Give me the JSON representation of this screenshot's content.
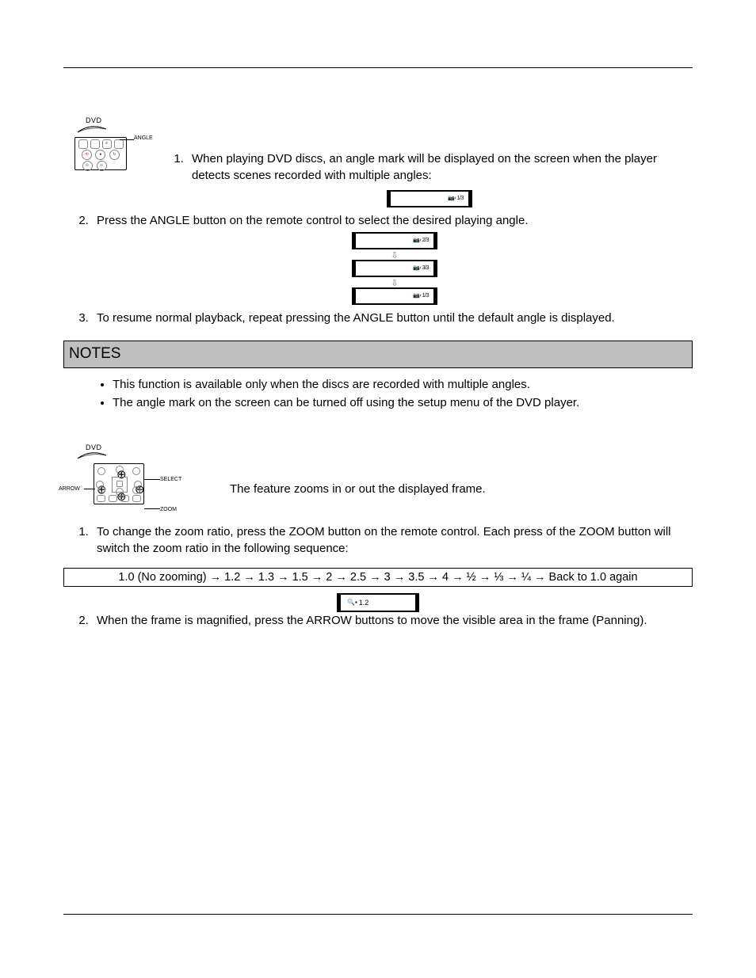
{
  "illus1": {
    "dvd": "DVD",
    "angle": "ANGLE"
  },
  "sec1": {
    "item1": "When playing DVD discs, an angle mark will be displayed on the screen when the player detects scenes recorded with multiple angles:",
    "osd1": "1/3",
    "item2": "Press the ANGLE button on the remote control to select the desired playing angle.",
    "osd2a": "2/3",
    "osd2b": "3/3",
    "osd2c": "1/3",
    "item3": "To resume normal playback, repeat pressing the ANGLE button until the default angle is displayed."
  },
  "notes": {
    "heading": "NOTES",
    "b1": "This function is available only when the discs are recorded with multiple angles.",
    "b2": "The angle mark on the screen can be turned off using the setup menu of the DVD player."
  },
  "illus2": {
    "dvd": "DVD",
    "arrow": "ARROW",
    "select": "SELECT",
    "zoom": "ZOOM"
  },
  "sec2": {
    "intro": "The feature zooms in or out the displayed frame.",
    "item1": "To change the zoom ratio, press the ZOOM button on the remote control.  Each press of the ZOOM button will switch the zoom ratio in the following sequence:",
    "seq": "1.0 (No zooming) → 1.2 → 1.3 → 1.5 → 2 → 2.5 → 3 → 3.5 → 4 → ½ → ⅓ → ¼ → Back to 1.0 again",
    "zoom_osd": "1.2",
    "item2": "When the frame is magnified, press the ARROW buttons to move the visible area in the frame (Panning)."
  }
}
